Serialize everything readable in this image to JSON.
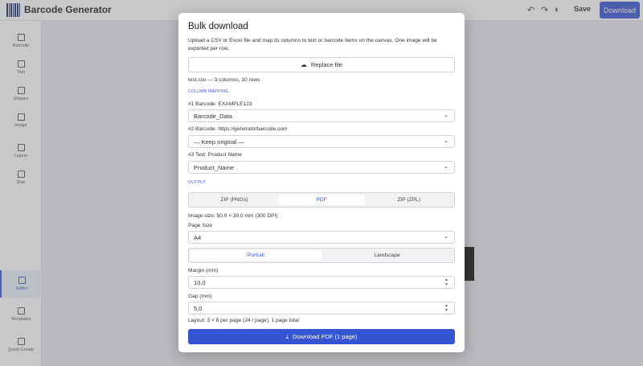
{
  "app": {
    "title": "Barcode Generator"
  },
  "toolbar": {
    "save_label": "Save",
    "download_label": "Download"
  },
  "sidebar": {
    "items": [
      {
        "label": "Barcode",
        "icon": "barcode-icon"
      },
      {
        "label": "Text",
        "icon": "text-icon"
      },
      {
        "label": "Shapes",
        "icon": "shapes-icon"
      },
      {
        "label": "Image",
        "icon": "image-icon"
      },
      {
        "label": "Layers",
        "icon": "layers-icon"
      },
      {
        "label": "Size",
        "icon": "size-icon"
      },
      {
        "label": "Editor",
        "icon": "pencil-icon"
      },
      {
        "label": "Templates",
        "icon": "templates-icon"
      },
      {
        "label": "Quick Create",
        "icon": "file-icon"
      }
    ]
  },
  "modal": {
    "title": "Bulk download",
    "description": "Upload a CSV or Excel file and map its columns to text or barcode items on the canvas. One image will be exported per row.",
    "replace_label": "Replace file",
    "file_info": "test.csv — 3 columns, 10 rows",
    "column_mapping_label": "COLUMN MAPPING",
    "mappings": [
      {
        "label": "#1 Barcode: EXAMPLE123",
        "value": "Barcode_Data"
      },
      {
        "label": "#2 Barcode: https://generatorbarcode.com",
        "value": "— Keep original —"
      },
      {
        "label": "#3 Text: Product Name",
        "value": "Product_Name"
      }
    ],
    "output_label": "OUTPUT",
    "format_options": [
      "ZIP (PNGs)",
      "PDF",
      "ZIP (ZPL)"
    ],
    "format_selected": "PDF",
    "image_size": "Image size: 50.0 × 30.0 mm (300 DPI)",
    "page_size_label": "Page Size",
    "page_size_value": "A4",
    "orientation_options": [
      "Portrait",
      "Landscape"
    ],
    "orientation_selected": "Portrait",
    "margin_label": "Margin (mm)",
    "margin_value": "10,0",
    "gap_label": "Gap (mm)",
    "gap_value": "5,0",
    "layout_info": "Layout: 3 × 8 per page (24 / page), 1 page total",
    "download_pdf_label": "Download PDF (1 page)"
  },
  "colors": {
    "accent": "#3554d1",
    "brand_dark": "#1b2a6b"
  }
}
